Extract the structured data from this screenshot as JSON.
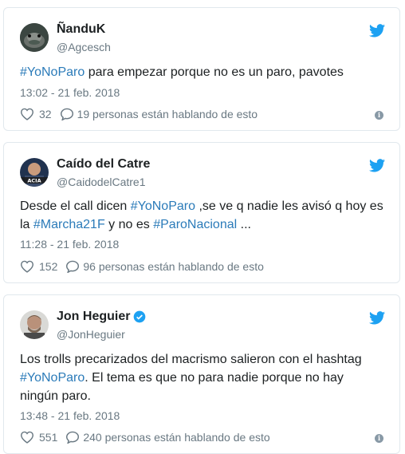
{
  "colors": {
    "accent": "#1da1f2",
    "link": "#2b7bb9",
    "muted": "#697882"
  },
  "tweets": [
    {
      "name": "ÑanduK",
      "handle": "@Agcesch",
      "text_parts": [
        {
          "t": "#YoNoParo",
          "tag": true
        },
        {
          "t": " para empezar porque no es un paro, pavotes",
          "tag": false
        }
      ],
      "time": "13:02 - 21 feb. 2018",
      "likes": "32",
      "replies": "19 personas están hablando de esto",
      "verified": false
    },
    {
      "name": "Caído del Catre",
      "handle": "@CaidodelCatre1",
      "avatar_text": "ACIA",
      "text_parts": [
        {
          "t": "Desde el call dicen ",
          "tag": false
        },
        {
          "t": "#YoNoParo",
          "tag": true
        },
        {
          "t": " ,se ve q nadie les avisó q hoy es la ",
          "tag": false
        },
        {
          "t": "#Marcha21F",
          "tag": true
        },
        {
          "t": " y no es ",
          "tag": false
        },
        {
          "t": "#ParoNacional",
          "tag": true
        },
        {
          "t": " ...",
          "tag": false
        }
      ],
      "time": "11:28 - 21 feb. 2018",
      "likes": "152",
      "replies": "96 personas están hablando de esto",
      "verified": false
    },
    {
      "name": "Jon Heguier",
      "handle": "@JonHeguier",
      "text_parts": [
        {
          "t": "Los trolls precarizados del macrismo salieron con el hashtag ",
          "tag": false
        },
        {
          "t": "#YoNoParo",
          "tag": true
        },
        {
          "t": ". El tema es que no para nadie porque no hay ningún paro.",
          "tag": false
        }
      ],
      "time": "13:48 - 21 feb. 2018",
      "likes": "551",
      "replies": "240 personas están hablando de esto",
      "verified": true
    }
  ]
}
